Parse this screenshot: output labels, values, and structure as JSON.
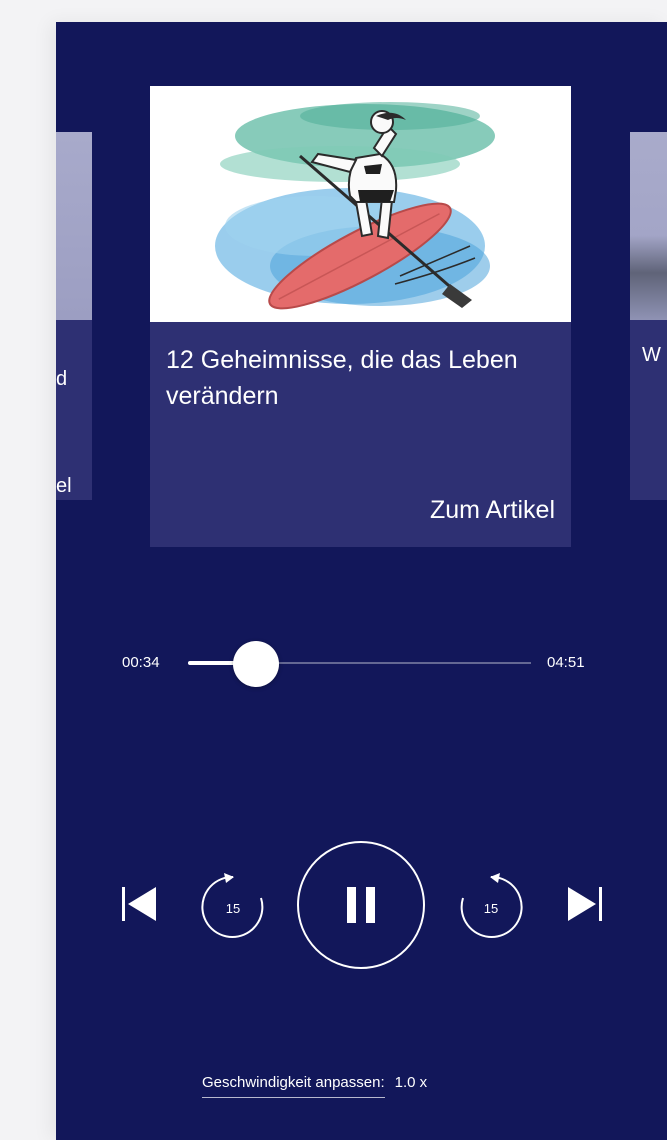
{
  "carousel": {
    "left_peek": {
      "line1": "d",
      "line2": "el"
    },
    "main_card": {
      "title": "12 Geheimnisse, die das Leben verändern",
      "link_label": "Zum Artikel"
    },
    "right_peek": {
      "line1": "W"
    }
  },
  "player": {
    "elapsed": "00:34",
    "total": "04:51",
    "progress_fraction": 0.117,
    "rewind_label": "15",
    "forward_label": "15",
    "speed_label": "Geschwindigkeit anpassen:",
    "speed_value": "1.0 x"
  },
  "colors": {
    "background": "#12175a",
    "card": "#2e3073",
    "accent": "#ffffff"
  },
  "icons": {
    "skip_prev": "skip-previous-icon",
    "rewind": "rewind-15-icon",
    "pause": "pause-icon",
    "forward": "forward-15-icon",
    "skip_next": "skip-next-icon"
  }
}
